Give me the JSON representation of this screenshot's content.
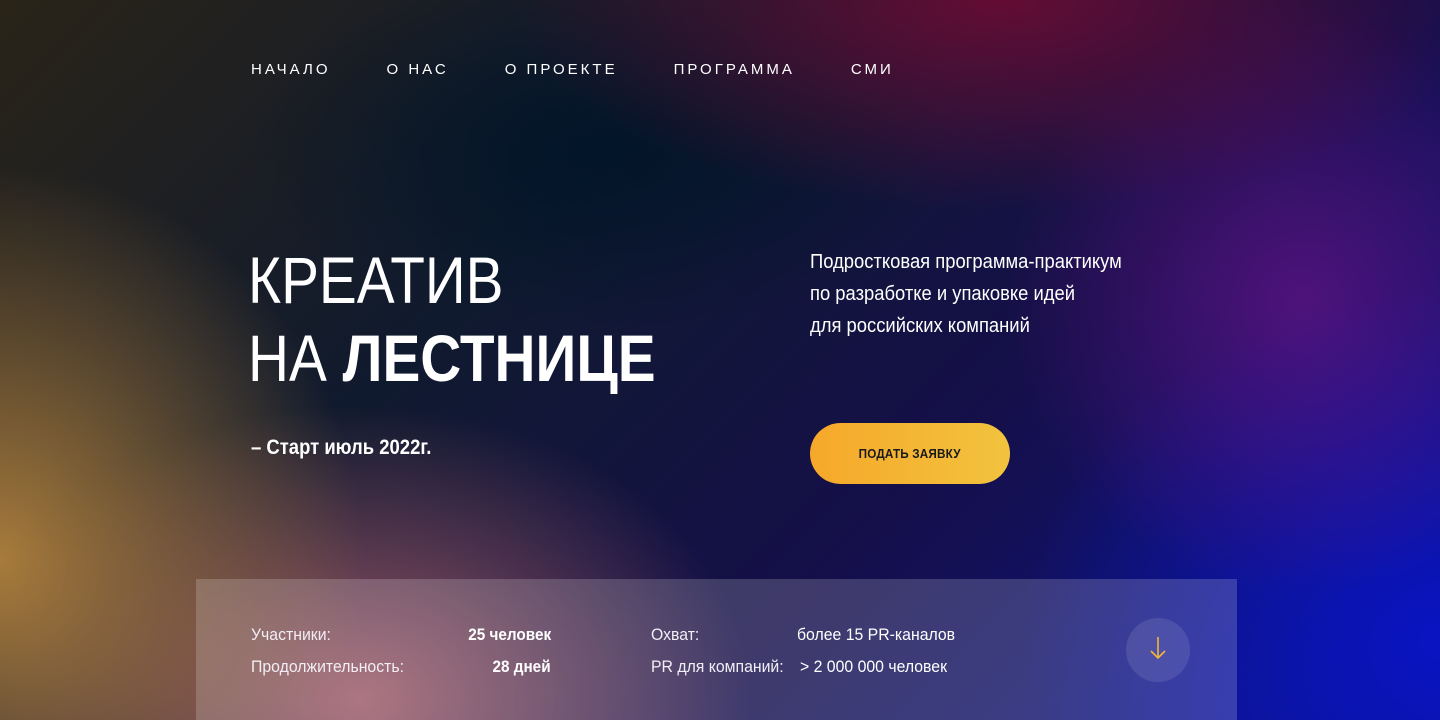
{
  "nav": {
    "items": [
      {
        "label": "НАЧАЛО"
      },
      {
        "label": "О НАС"
      },
      {
        "label": "О ПРОЕКТЕ"
      },
      {
        "label": "ПРОГРАММА"
      },
      {
        "label": "СМИ"
      }
    ]
  },
  "hero": {
    "title_line1": "КРЕАТИВ",
    "title_line2_light": "НА",
    "title_line2_bold": "ЛЕСТНИЦЕ",
    "start": "– Старт июль 2022г.",
    "description": [
      "Подростковая программа-практикум",
      "по разработке и упаковке идей",
      "для российских компаний"
    ],
    "cta_label": "ПОДАТЬ ЗАЯВКУ"
  },
  "stats": {
    "participants_label": "Участники:",
    "participants_value": "25 человек",
    "duration_label": "Продолжительность:",
    "duration_value": "28 дней",
    "reach_label": "Охват:",
    "reach_value": "более 15 PR-каналов",
    "pr_label": "PR для компаний:",
    "pr_value": "> 2 000 000 человек"
  },
  "icons": {
    "scroll_down": "arrow-down-icon"
  },
  "colors": {
    "accent": "#f6a82a",
    "arrow": "#f2b63a"
  }
}
